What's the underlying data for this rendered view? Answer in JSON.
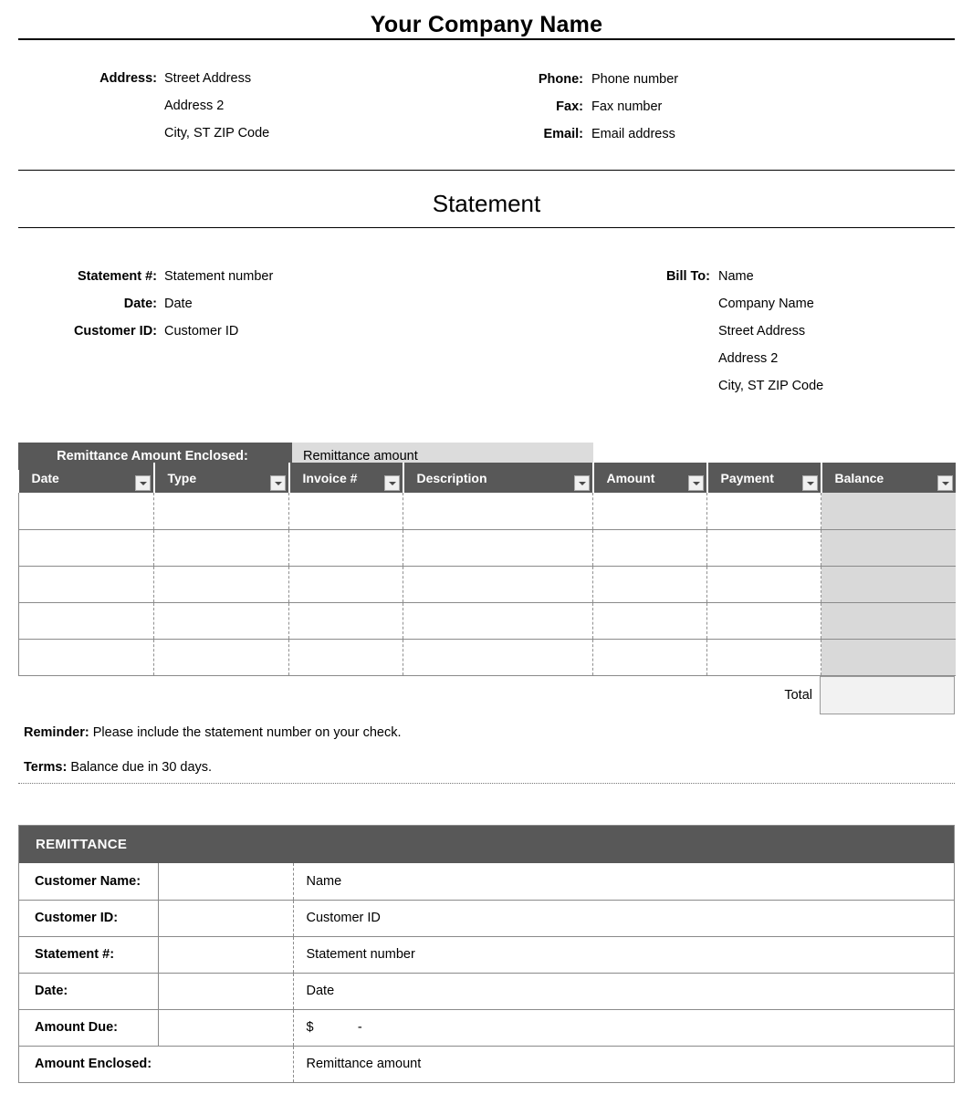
{
  "company": {
    "name": "Your Company Name",
    "contact_left": [
      {
        "label": "Address:",
        "value": "Street Address"
      },
      {
        "label": "",
        "value": "Address 2"
      },
      {
        "label": "",
        "value": "City, ST  ZIP Code"
      }
    ],
    "contact_right": [
      {
        "label": "Phone:",
        "value": "Phone number"
      },
      {
        "label": "Fax:",
        "value": "Fax number"
      },
      {
        "label": "Email:",
        "value": "Email address"
      }
    ]
  },
  "doc": {
    "title": "Statement"
  },
  "meta_left": [
    {
      "label": "Statement #:",
      "value": "Statement number"
    },
    {
      "label": "Date:",
      "value": "Date"
    },
    {
      "label": "Customer ID:",
      "value": "Customer ID"
    }
  ],
  "bill_to": {
    "label": "Bill To:",
    "lines": [
      "Name",
      "Company Name",
      "Street Address",
      "Address 2",
      "City, ST  ZIP Code"
    ]
  },
  "remittance_bar": {
    "label": "Remittance Amount Enclosed:",
    "value": "Remittance amount"
  },
  "transactions": {
    "columns": [
      "Date",
      "Type",
      "Invoice #",
      "Description",
      "Amount",
      "Payment",
      "Balance"
    ],
    "rows": [
      [
        "",
        "",
        "",
        "",
        "",
        "",
        ""
      ],
      [
        "",
        "",
        "",
        "",
        "",
        "",
        ""
      ],
      [
        "",
        "",
        "",
        "",
        "",
        "",
        ""
      ],
      [
        "",
        "",
        "",
        "",
        "",
        "",
        ""
      ],
      [
        "",
        "",
        "",
        "",
        "",
        "",
        ""
      ]
    ],
    "total_label": "Total",
    "total_value": ""
  },
  "notes": {
    "reminder_label": "Reminder:",
    "reminder_text": "Please include the statement number on your check.",
    "terms_label": "Terms:",
    "terms_text": "Balance due in 30 days."
  },
  "remittance_section": {
    "heading": "REMITTANCE",
    "rows": [
      {
        "key": "Customer Name:",
        "value": "Name"
      },
      {
        "key": "Customer ID:",
        "value": "Customer ID"
      },
      {
        "key": "Statement #:",
        "value": "Statement number"
      },
      {
        "key": "Date:",
        "value": "Date"
      },
      {
        "key": "Amount Due:",
        "value": "$            -"
      },
      {
        "key": "Amount Enclosed:",
        "value": "Remittance amount"
      }
    ]
  },
  "colors": {
    "header_dark": "#585858",
    "shaded_cell": "#d9d9d9",
    "value_bar": "#dcdcdc",
    "total_cell": "#f2f2f2",
    "handle_blue": "#2f54a8"
  }
}
